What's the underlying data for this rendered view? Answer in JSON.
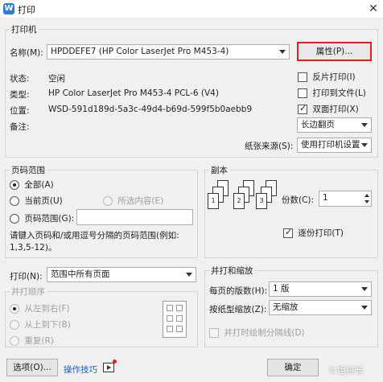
{
  "window": {
    "title": "打印",
    "app_icon_letter": "W"
  },
  "printer": {
    "group_label": "打印机",
    "name_label": "名称(M):",
    "name_value": "HPDDEFE7 (HP Color LaserJet Pro M453-4)",
    "properties_label": "属性(P)...",
    "status_label": "状态:",
    "status_value": "空闲",
    "type_label": "类型:",
    "type_value": "HP Color LaserJet Pro M453-4 PCL-6 (V4)",
    "location_label": "位置:",
    "location_value": "WSD-591d189d-5a3c-49d4-b69d-599f5b0aebb9",
    "comment_label": "备注:",
    "reverse_print": {
      "label": "反片打印(I)",
      "checked": false
    },
    "print_to_file": {
      "label": "打印到文件(L)",
      "checked": false
    },
    "duplex": {
      "label": "双面打印(X)",
      "checked": true
    },
    "flip_value": "长边翻页",
    "source_label": "纸张来源(S):",
    "source_value": "使用打印机设置"
  },
  "page_range": {
    "group_label": "页码范围",
    "all_label": "全部(A)",
    "current_label": "当前页(U)",
    "selection_label": "所选内容(E)",
    "range_label": "页码范围(G):",
    "range_value": "",
    "hint": "请键入页码和/或用逗号分隔的页码范围(例如: 1,3,5-12)。"
  },
  "copies": {
    "group_label": "副本",
    "count_label": "份数(C):",
    "count_value": "1",
    "collate": {
      "label": "逐份打印(T)",
      "checked": true
    },
    "page_labels": [
      "1",
      "2",
      "3"
    ]
  },
  "print_what": {
    "label": "打印(N):",
    "value": "范围中所有页面"
  },
  "order": {
    "group_label": "并打顺序",
    "left_to_right": "从左到右(F)",
    "top_to_bottom": "从上到下(B)",
    "repeat": "重复(R)"
  },
  "zoom": {
    "group_label": "并打和缩放",
    "per_sheet_label": "每页的版数(H):",
    "per_sheet_value": "1 版",
    "scale_label": "按纸型缩放(Z):",
    "scale_value": "无缩放",
    "draw_lines": {
      "label": "并打时绘制分隔线(D)",
      "checked": false
    }
  },
  "footer": {
    "options_label": "选项(O)...",
    "tips_label": "操作技巧",
    "ok_label": "确定",
    "watermark": "©姐拼长"
  }
}
